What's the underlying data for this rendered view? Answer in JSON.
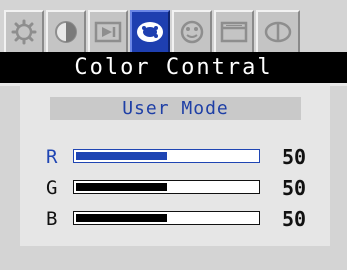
{
  "tabs": [
    {
      "icon": "gear-icon",
      "active": false
    },
    {
      "icon": "contrast-icon",
      "active": false
    },
    {
      "icon": "image-position-icon",
      "active": false
    },
    {
      "icon": "color-palette-icon",
      "active": true
    },
    {
      "icon": "face-icon",
      "active": false
    },
    {
      "icon": "window-icon",
      "active": false
    },
    {
      "icon": "input-icon",
      "active": false
    }
  ],
  "title": "Color Contral",
  "mode": {
    "label": "User Mode"
  },
  "channels": [
    {
      "label": "R",
      "value": "50",
      "level": 0.5,
      "selected": true
    },
    {
      "label": "G",
      "value": "50",
      "level": 0.5,
      "selected": false
    },
    {
      "label": "B",
      "value": "50",
      "level": 0.5,
      "selected": false
    }
  ],
  "colors": {
    "accent": "#1e3fb0",
    "selected_text": "#1f45b3",
    "title_bg": "#000000"
  }
}
